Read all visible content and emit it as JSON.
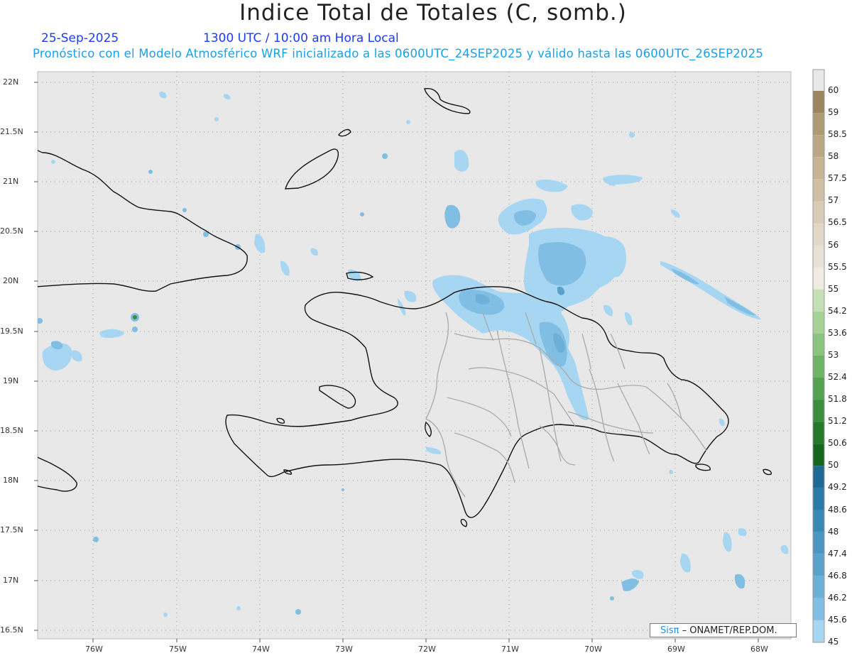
{
  "header": {
    "title": "Indice Total de Totales (C, somb.)",
    "date": "25-Sep-2025",
    "time": "1300 UTC / 10:00 am Hora Local",
    "description": "Pronóstico con el Modelo Atmosférico WRF inicializado a las 0600UTC_24SEP2025 y válido hasta las  0600UTC_26SEP2025"
  },
  "axes": {
    "lat_labels": [
      "22N",
      "21.5N",
      "21N",
      "20.5N",
      "20N",
      "19.5N",
      "19N",
      "18.5N",
      "18N",
      "17.5N",
      "17N",
      "16.5N"
    ],
    "lon_labels": [
      "76W",
      "75W",
      "74W",
      "73W",
      "72W",
      "71W",
      "70W",
      "69W",
      "68W"
    ]
  },
  "colorbar": {
    "labels": [
      "60",
      "59",
      "58.5",
      "58",
      "57.5",
      "57",
      "56.5",
      "56",
      "55.5",
      "55",
      "54.2",
      "53.6",
      "53",
      "52.4",
      "51.8",
      "51.2",
      "50.6",
      "50",
      "49.2",
      "48.6",
      "48",
      "47.4",
      "46.8",
      "46.2",
      "45.6",
      "45"
    ],
    "colors": [
      "#e8e8e8",
      "#9c8560",
      "#b09a74",
      "#bca784",
      "#c6b494",
      "#cfbfa5",
      "#d8ccb6",
      "#e0d7c6",
      "#e8e2d6",
      "#f0ece4",
      "#c2e0b4",
      "#a6d298",
      "#8ac47e",
      "#6db465",
      "#52a250",
      "#3a8e3c",
      "#25792a",
      "#14671c",
      "#1f6a94",
      "#2b7aa8",
      "#3a88b6",
      "#4a95c2",
      "#5aa2cc",
      "#6cb0d8",
      "#80bfe3",
      "#a6d6f2"
    ]
  },
  "footer": {
    "brand": "Sisπ",
    "credit": "– ONAMET/REP.DOM."
  },
  "chart_data": {
    "type": "heatmap",
    "variable": "Total Totals index (C)",
    "lon_range": [
      -76.7,
      -67.6
    ],
    "lat_range": [
      16.45,
      22.1
    ],
    "shaded_threshold_min": 45
  }
}
